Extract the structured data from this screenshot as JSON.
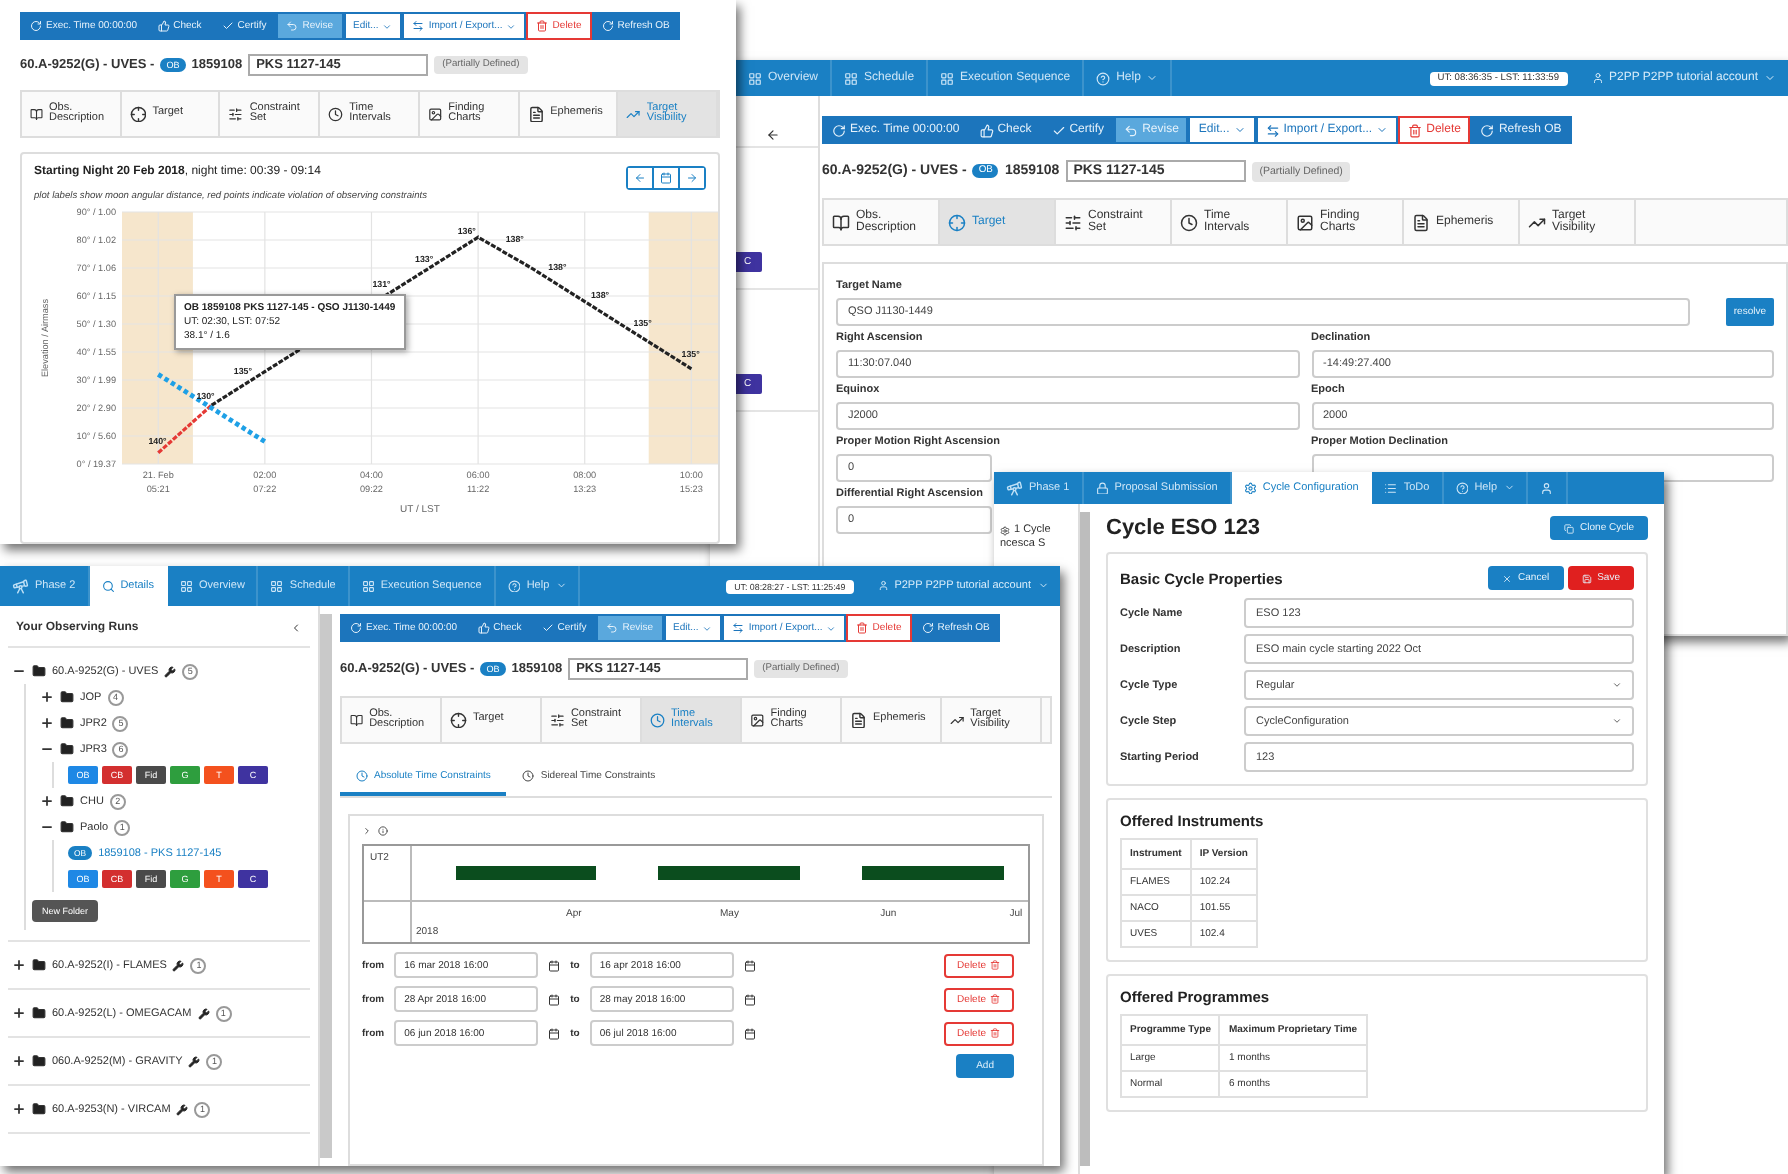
{
  "target_window": {
    "nav": [
      {
        "label": "Overview",
        "kind": "link"
      },
      {
        "label": "Schedule",
        "kind": "link"
      },
      {
        "label": "Execution Sequence",
        "kind": "link"
      },
      {
        "label": "Help",
        "kind": "dropdown"
      }
    ],
    "clock": "UT: 08:36:35 - LST: 11:33:59",
    "account": "P2PP P2PP tutorial account",
    "sidebar_badges": [
      "C",
      "C"
    ],
    "toolbar": [
      {
        "label": "Exec. Time 00:00:00",
        "kind": "primary"
      },
      {
        "label": "Check",
        "kind": "primary"
      },
      {
        "label": "Certify",
        "kind": "primary"
      },
      {
        "label": "Revise",
        "kind": "active"
      },
      {
        "label": "Edit...",
        "kind": "dropdown"
      },
      {
        "label": "Import / Export...",
        "kind": "dropdown"
      },
      {
        "label": "Delete",
        "kind": "danger"
      },
      {
        "label": "Refresh OB",
        "kind": "primary"
      }
    ],
    "header": {
      "run": "60.A-9252(G) - UVES -",
      "badge": "OB",
      "ob_id": "1859108",
      "ob_name": "PKS 1127-145",
      "status": "(Partially Defined)"
    },
    "tabs": [
      {
        "label": "Obs. Description",
        "selected": false
      },
      {
        "label": "Target",
        "selected": true
      },
      {
        "label": "Constraint Set",
        "selected": false
      },
      {
        "label": "Time Intervals",
        "selected": false
      },
      {
        "label": "Finding Charts",
        "selected": false
      },
      {
        "label": "Ephemeris",
        "selected": false
      },
      {
        "label": "Target Visibility",
        "selected": false
      }
    ],
    "target_name": {
      "label": "Target Name",
      "value": "QSO J1130-1449"
    },
    "resolve_button": "resolve",
    "fields": [
      {
        "label": "Right Ascension",
        "value": "11:30:07.040"
      },
      {
        "label": "Declination",
        "value": "-14:49:27.400"
      },
      {
        "label": "Equinox",
        "value": "J2000"
      },
      {
        "label": "Epoch",
        "value": "2000"
      },
      {
        "label": "Proper Motion Right Ascension",
        "value": "0"
      },
      {
        "label": "Proper Motion Declination"
      },
      {
        "label": "Differential Right Ascension",
        "value": "0"
      }
    ]
  },
  "visibility_window": {
    "toolbar": [
      {
        "label": "Exec. Time 00:00:00",
        "kind": "primary"
      },
      {
        "label": "Check",
        "kind": "primary"
      },
      {
        "label": "Certify",
        "kind": "primary"
      },
      {
        "label": "Revise",
        "kind": "active"
      },
      {
        "label": "Edit...",
        "kind": "dropdown"
      },
      {
        "label": "Import / Export...",
        "kind": "dropdown"
      },
      {
        "label": "Delete",
        "kind": "danger"
      },
      {
        "label": "Refresh OB",
        "kind": "primary"
      }
    ],
    "header": {
      "run": "60.A-9252(G) - UVES -",
      "badge": "OB",
      "ob_id": "1859108",
      "ob_name": "PKS 1127-145",
      "status": "(Partially Defined)"
    },
    "tabs": [
      {
        "label": "Obs. Description",
        "selected": false
      },
      {
        "label": "Target",
        "selected": false
      },
      {
        "label": "Constraint Set",
        "selected": false
      },
      {
        "label": "Time Intervals",
        "selected": false
      },
      {
        "label": "Finding Charts",
        "selected": false
      },
      {
        "label": "Ephemeris",
        "selected": false
      },
      {
        "label": "Target Visibility",
        "selected": true
      }
    ],
    "note": "plot labels show moon angular distance, red points indicate violation of observing constraints",
    "tooltip": {
      "title": "OB 1859108 PKS 1127-145 - QSO J1130-1449",
      "time": "UT: 02:30, LST: 07:52",
      "reading": "38.1° / 1.6"
    },
    "chart": {
      "title": "**Starting Night 20 Feb 2018**, night time: 00:39 - 09:14",
      "xlabel": "UT / LST",
      "ylabel": "Elevation / Airmass",
      "xticks": [
        {
          "ut": "21. Feb",
          "lst": "05:21"
        },
        {
          "ut": "02:00",
          "lst": "07:22"
        },
        {
          "ut": "04:00",
          "lst": "09:22"
        },
        {
          "ut": "06:00",
          "lst": "11:22"
        },
        {
          "ut": "08:00",
          "lst": "13:23"
        },
        {
          "ut": "10:00",
          "lst": "15:23"
        }
      ],
      "yticks": [
        "90° / 1.00",
        "80° / 1.02",
        "70° / 1.06",
        "60° / 1.15",
        "50° / 1.30",
        "40° / 1.55",
        "30° / 1.99",
        "20° / 2.90",
        "10° / 5.60",
        "0° / 19.37"
      ],
      "point_labels": [
        "140°",
        "130°",
        "135°",
        "131°",
        "133°",
        "136°",
        "138°",
        "138°",
        "138°",
        "135°",
        "135°"
      ]
    }
  },
  "runs_window": {
    "nav": [
      {
        "label": "Phase 2",
        "kind": "logo",
        "selected": false
      },
      {
        "label": "Details",
        "kind": "search",
        "selected": true
      },
      {
        "label": "Overview",
        "kind": "link",
        "selected": false
      },
      {
        "label": "Schedule",
        "kind": "link",
        "selected": false
      },
      {
        "label": "Execution Sequence",
        "kind": "link",
        "selected": false
      },
      {
        "label": "Help",
        "kind": "dropdown",
        "selected": false
      }
    ],
    "clock": "UT: 08:28:27 - LST: 11:25:49",
    "account": "P2PP P2PP tutorial account",
    "sidebar_title": "Your Observing Runs",
    "tree": [
      {
        "kind": "run",
        "label": "60.A-9252(G) - UVES",
        "count": "5",
        "expanded": true,
        "children": [
          {
            "kind": "folder",
            "label": "JOP",
            "count": "4",
            "expanded": false
          },
          {
            "kind": "folder",
            "label": "JPR2",
            "count": "5",
            "expanded": false
          },
          {
            "kind": "folder",
            "label": "JPR3",
            "count": "6",
            "expanded": true,
            "children": [
              {
                "kind": "actions",
                "buttons": [
                  {
                    "label": "OB",
                    "color": "#1e88e5"
                  },
                  {
                    "label": "CB",
                    "color": "#d32f2f"
                  },
                  {
                    "label": "Fid",
                    "color": "#4a4a4a"
                  },
                  {
                    "label": "G",
                    "color": "#2e9e3e"
                  },
                  {
                    "label": "T",
                    "color": "#f4511e"
                  },
                  {
                    "label": "C",
                    "color": "#3f33a0"
                  }
                ]
              }
            ]
          },
          {
            "kind": "folder",
            "label": "CHU",
            "count": "2",
            "expanded": false
          },
          {
            "kind": "folder",
            "label": "Paolo",
            "count": "1",
            "expanded": true,
            "children": [
              {
                "kind": "ob",
                "badge": "OB",
                "label": "1859108 - PKS 1127-145"
              },
              {
                "kind": "actions",
                "buttons": [
                  {
                    "label": "OB",
                    "color": "#1e88e5"
                  },
                  {
                    "label": "CB",
                    "color": "#d32f2f"
                  },
                  {
                    "label": "Fid",
                    "color": "#4a4a4a"
                  },
                  {
                    "label": "G",
                    "color": "#2e9e3e"
                  },
                  {
                    "label": "T",
                    "color": "#f4511e"
                  },
                  {
                    "label": "C",
                    "color": "#3f33a0"
                  }
                ]
              }
            ]
          },
          {
            "kind": "button",
            "label": "New Folder"
          }
        ]
      },
      {
        "kind": "run",
        "label": "60.A-9252(I) - FLAMES",
        "count": "1",
        "expanded": false
      },
      {
        "kind": "run",
        "label": "60.A-9252(L) - OMEGACAM",
        "count": "1",
        "expanded": false
      },
      {
        "kind": "run",
        "label": "060.A-9252(M) - GRAVITY",
        "count": "1",
        "expanded": false
      },
      {
        "kind": "run",
        "label": "60.A-9253(N) - VIRCAM",
        "count": "1",
        "expanded": false
      }
    ],
    "toolbar": [
      {
        "label": "Exec. Time 00:00:00",
        "kind": "primary"
      },
      {
        "label": "Check",
        "kind": "primary"
      },
      {
        "label": "Certify",
        "kind": "primary"
      },
      {
        "label": "Revise",
        "kind": "active"
      },
      {
        "label": "Edit...",
        "kind": "dropdown"
      },
      {
        "label": "Import / Export...",
        "kind": "dropdown"
      },
      {
        "label": "Delete",
        "kind": "danger"
      },
      {
        "label": "Refresh OB",
        "kind": "primary"
      }
    ],
    "header": {
      "run": "60.A-9252(G) - UVES -",
      "badge": "OB",
      "ob_id": "1859108",
      "ob_name": "PKS 1127-145",
      "status": "(Partially Defined)"
    },
    "tabs": [
      {
        "label": "Obs. Description",
        "selected": false
      },
      {
        "label": "Target",
        "selected": false
      },
      {
        "label": "Constraint Set",
        "selected": false
      },
      {
        "label": "Time Intervals",
        "selected": true
      },
      {
        "label": "Finding Charts",
        "selected": false
      },
      {
        "label": "Ephemeris",
        "selected": false
      },
      {
        "label": "Target Visibility",
        "selected": false
      }
    ],
    "subtabs": [
      {
        "label": "Absolute Time Constraints",
        "selected": true
      },
      {
        "label": "Sidereal Time Constraints",
        "selected": false
      }
    ],
    "timeline": {
      "scale": "UT2",
      "months": [
        "Apr",
        "May",
        "Jun",
        "Jul"
      ],
      "year": "2018"
    },
    "intervals": [
      {
        "from_label": "from",
        "from": "16 mar 2018 16:00",
        "to_label": "to",
        "to": "16 apr 2018 16:00",
        "delete": "Delete"
      },
      {
        "from_label": "from",
        "from": "28 Apr 2018 16:00",
        "to_label": "to",
        "to": "28 may 2018 16:00",
        "delete": "Delete"
      },
      {
        "from_label": "from",
        "from": "06 jun 2018 16:00",
        "to_label": "to",
        "to": "06 jul 2018 16:00",
        "delete": "Delete"
      }
    ],
    "add_button": "Add"
  },
  "cycle_window": {
    "nav": [
      {
        "label": "Phase 1",
        "kind": "logo",
        "selected": false
      },
      {
        "label": "Proposal Submission",
        "kind": "lock",
        "selected": false
      },
      {
        "label": "Cycle Configuration",
        "kind": "gear",
        "selected": true
      },
      {
        "label": "ToDo",
        "kind": "list",
        "selected": false
      },
      {
        "label": "Help",
        "kind": "dropdown",
        "selected": false
      },
      {
        "kind": "user",
        "selected": false
      }
    ],
    "sidebar": [
      "1 Cycle",
      "ncesca S"
    ],
    "title": "Cycle ESO 123",
    "clone_button": "Clone Cycle",
    "basic": {
      "title": "Basic Cycle Properties",
      "cancel": "Cancel",
      "save": "Save",
      "rows": [
        {
          "label": "Cycle Name",
          "value": "ESO 123",
          "kind": "text"
        },
        {
          "label": "Description",
          "value": "ESO main cycle starting 2022 Oct",
          "kind": "text"
        },
        {
          "label": "Cycle Type",
          "value": "Regular",
          "kind": "select"
        },
        {
          "label": "Cycle Step",
          "value": "CycleConfiguration",
          "kind": "select"
        },
        {
          "label": "Starting Period",
          "value": "123",
          "kind": "text"
        }
      ]
    },
    "instruments": {
      "title": "Offered Instruments",
      "columns": [
        "Instrument",
        "IP Version"
      ],
      "rows": [
        [
          "FLAMES",
          "102.24"
        ],
        [
          "NACO",
          "101.55"
        ],
        [
          "UVES",
          "102.4"
        ]
      ]
    },
    "programmes": {
      "title": "Offered Programmes",
      "columns": [
        "Programme Type",
        "Maximum Proprietary Time"
      ],
      "rows": [
        [
          "Large",
          "1 months"
        ],
        [
          "Normal",
          "6 months"
        ]
      ]
    }
  }
}
